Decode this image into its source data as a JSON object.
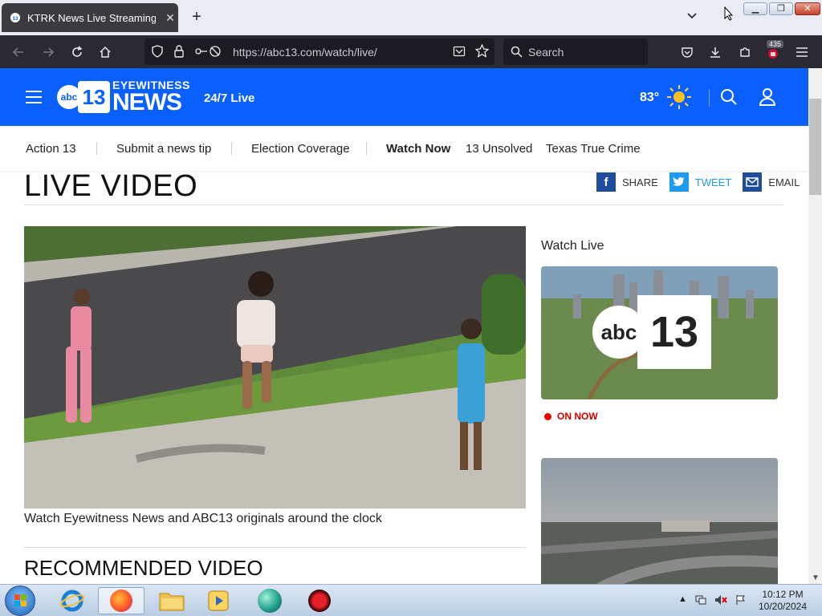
{
  "browser": {
    "tab_title": "KTRK News Live Streaming Vide",
    "tab_favicon": "abc13-favicon",
    "new_tab_label": "+",
    "url": "https://abc13.com/watch/live/",
    "search_placeholder": "Search",
    "notification_count": "435"
  },
  "site_header": {
    "logo_abc": "abc",
    "logo_13": "13",
    "logo_eyewitness": "EYEWITNESS",
    "logo_news": "NEWS",
    "live_label": "24/7 Live",
    "temperature": "83°",
    "weather_icon": "sun-icon",
    "brand_color": "#0a60ff"
  },
  "subnav": {
    "items": [
      {
        "label": "Action 13"
      },
      {
        "label": "Submit a news tip"
      },
      {
        "label": "Election Coverage"
      },
      {
        "label": "Watch Now"
      },
      {
        "label": "13 Unsolved"
      },
      {
        "label": "Texas True Crime"
      }
    ]
  },
  "content": {
    "title": "LIVE VIDEO",
    "share_label": "SHARE",
    "tweet_label": "TWEET",
    "email_label": "EMAIL",
    "video_caption": "Watch Eyewitness News and ABC13 originals around the clock",
    "recommended_heading": "RECOMMENDED VIDEO",
    "sidebar_heading": "Watch Live",
    "on_now_label": "ON NOW",
    "thumb1_logo_abc": "abc",
    "thumb1_logo_13": "13"
  },
  "taskbar": {
    "time": "10:12 PM",
    "date": "10/20/2024"
  }
}
